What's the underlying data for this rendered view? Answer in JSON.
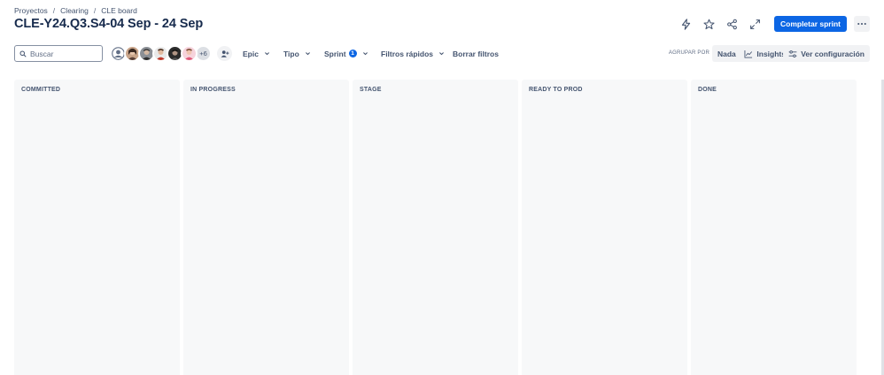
{
  "breadcrumb": [
    "Proyectos",
    "Clearing",
    "CLE board"
  ],
  "title": "CLE-Y24.Q3.S4-04 Sep - 24 Sep",
  "header": {
    "icons": [
      "lightning-icon",
      "star-icon",
      "share-icon",
      "expand-icon"
    ],
    "complete_label": "Completar sprint",
    "more_icon": "more-icon"
  },
  "toolbar": {
    "search_placeholder": "Buscar",
    "avatars_more": "+6",
    "filters": {
      "epic": "Epic",
      "tipo": "Tipo",
      "sprint": "Sprint",
      "sprint_count": "1",
      "filtros": "Filtros rápidos",
      "borrar": "Borrar filtros"
    },
    "group_by_label": "AGRUPAR POR",
    "group_by_value": "Nada",
    "insights_label": "Insights",
    "config_label": "Ver configuración"
  },
  "columns": [
    {
      "title": "COMMITTED"
    },
    {
      "title": "IN PROGRESS"
    },
    {
      "title": "STAGE"
    },
    {
      "title": "READY TO PROD"
    },
    {
      "title": "DONE"
    }
  ],
  "colors": {
    "primary": "#0c66e4",
    "column_bg": "#f7f8f9",
    "text": "#172b4d",
    "subtle_text": "#44546f"
  }
}
